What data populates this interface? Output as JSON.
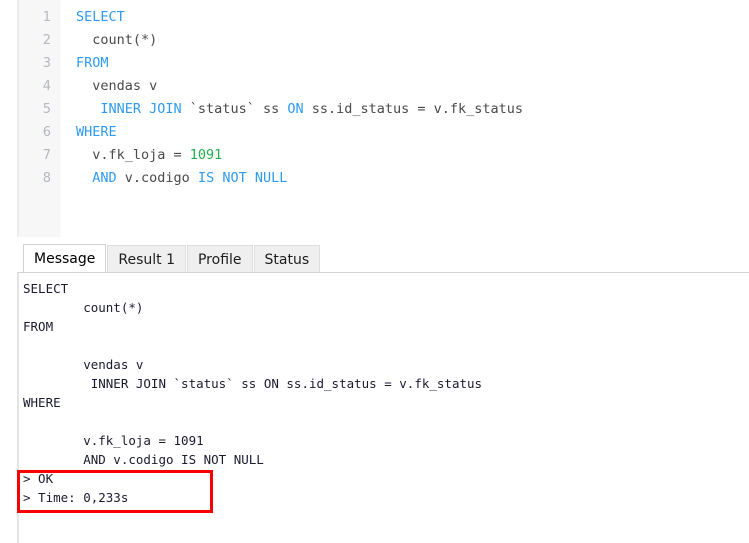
{
  "editor": {
    "name": "sql-editor",
    "line_numbers": [
      "1",
      "2",
      "3",
      "4",
      "5",
      "6",
      "7",
      "8"
    ],
    "lines": [
      {
        "n": "1",
        "segments": [
          {
            "t": "SELECT",
            "c": "kw"
          }
        ]
      },
      {
        "n": "2",
        "segments": [
          {
            "t": "  count(*)",
            "c": "ident"
          }
        ]
      },
      {
        "n": "3",
        "segments": [
          {
            "t": "FROM",
            "c": "kw"
          }
        ]
      },
      {
        "n": "4",
        "segments": [
          {
            "t": "  vendas v",
            "c": "ident"
          }
        ]
      },
      {
        "n": "5",
        "segments": [
          {
            "t": "   ",
            "c": "ident"
          },
          {
            "t": "INNER JOIN",
            "c": "kw"
          },
          {
            "t": " `status` ss ",
            "c": "ident"
          },
          {
            "t": "ON",
            "c": "kw"
          },
          {
            "t": " ss.id_status = v.fk_status",
            "c": "ident"
          }
        ]
      },
      {
        "n": "6",
        "segments": [
          {
            "t": "WHERE",
            "c": "kw"
          }
        ]
      },
      {
        "n": "7",
        "segments": [
          {
            "t": "  v.fk_loja = ",
            "c": "ident"
          },
          {
            "t": "1091",
            "c": "num"
          }
        ]
      },
      {
        "n": "8",
        "segments": [
          {
            "t": "  ",
            "c": "ident"
          },
          {
            "t": "AND",
            "c": "kw"
          },
          {
            "t": " v.codigo ",
            "c": "ident"
          },
          {
            "t": "IS NOT NULL",
            "c": "kw"
          }
        ]
      }
    ],
    "plain_sql": "SELECT\n  count(*)\nFROM\n  vendas v\n   INNER JOIN `status` ss ON ss.id_status = v.fk_status\nWHERE\n  v.fk_loja = 1091\n  AND v.codigo IS NOT NULL"
  },
  "tabs": [
    {
      "label": "Message",
      "active": true
    },
    {
      "label": "Result 1",
      "active": false
    },
    {
      "label": "Profile",
      "active": false
    },
    {
      "label": "Status",
      "active": false
    }
  ],
  "message": {
    "lines": [
      "SELECT",
      "        count(*)",
      "FROM",
      "",
      "        vendas v",
      "         INNER JOIN `status` ss ON ss.id_status = v.fk_status",
      "WHERE",
      "",
      "        v.fk_loja = 1091",
      "        AND v.codigo IS NOT NULL",
      "> OK",
      "> Time: 0,233s"
    ],
    "status_ok": "> OK",
    "elapsed_time": "> Time: 0,233s"
  },
  "annotation": {
    "name": "red-highlight-box",
    "color": "#f90000"
  },
  "colors": {
    "keyword": "#2e9bf0",
    "number": "#21b04b",
    "identifier": "#4a4a4a",
    "line_number": "#b4b8bf",
    "gutter_bg": "#f7f7f7",
    "tab_inactive_bg": "#efefef",
    "tab_active_bg": "#ffffff",
    "message_text": "#1b1b30",
    "annotation": "#f90000"
  }
}
